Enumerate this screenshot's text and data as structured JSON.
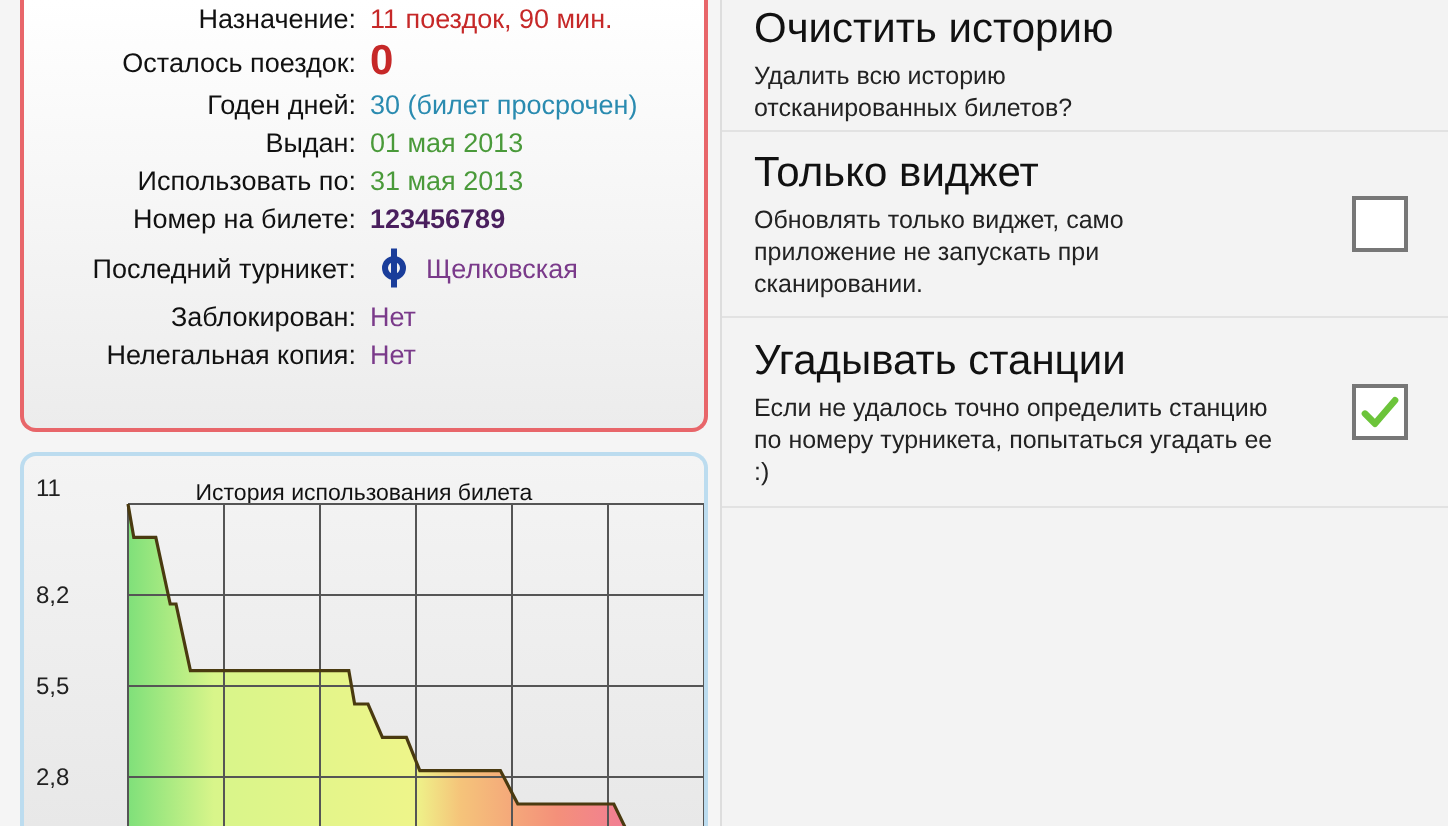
{
  "ticket": {
    "rows": [
      {
        "label": "Назначение:",
        "value": "11 поездок, 90 мин.",
        "kind": "text",
        "color": "#c62828"
      },
      {
        "label": "Осталось поездок:",
        "value": "0",
        "kind": "big",
        "color": "#c62828"
      },
      {
        "label": "Годен дней:",
        "value": "30 (билет просрочен)",
        "kind": "text",
        "color": "#2a8bb0"
      },
      {
        "label": "Выдан:",
        "value": "01 мая 2013",
        "kind": "text",
        "color": "#4a9a3a"
      },
      {
        "label": "Использовать по:",
        "value": "31 мая 2013",
        "kind": "text",
        "color": "#4a9a3a"
      },
      {
        "label": "Номер на билете:",
        "value": "123456789",
        "kind": "bold",
        "color": "#4a1f5e"
      },
      {
        "label": "Последний турникет:",
        "value": "Щелковская",
        "kind": "station",
        "color": "#7a3a8a"
      },
      {
        "label": "Заблокирован:",
        "value": "Нет",
        "kind": "text",
        "color": "#7a3a8a"
      },
      {
        "label": "Нелегальная копия:",
        "value": "Нет",
        "kind": "text",
        "color": "#7a3a8a"
      }
    ]
  },
  "history": {
    "title": "История использования билета",
    "y_labels": [
      "11",
      "8,2",
      "5,5",
      "2,8"
    ]
  },
  "settings": [
    {
      "kind": "action",
      "title": "Очистить историю",
      "summary": "Удалить всю историю отсканированных билетов?"
    },
    {
      "kind": "checkbox",
      "title": "Только виджет",
      "summary": "Обновлять только виджет, само приложение не запускать при сканировании.",
      "checked": false
    },
    {
      "kind": "checkbox",
      "title": "Угадывать станции",
      "summary": "Если не удалось точно определить станцию по номеру турникета, попытаться угадать ее :)",
      "checked": true
    }
  ]
}
